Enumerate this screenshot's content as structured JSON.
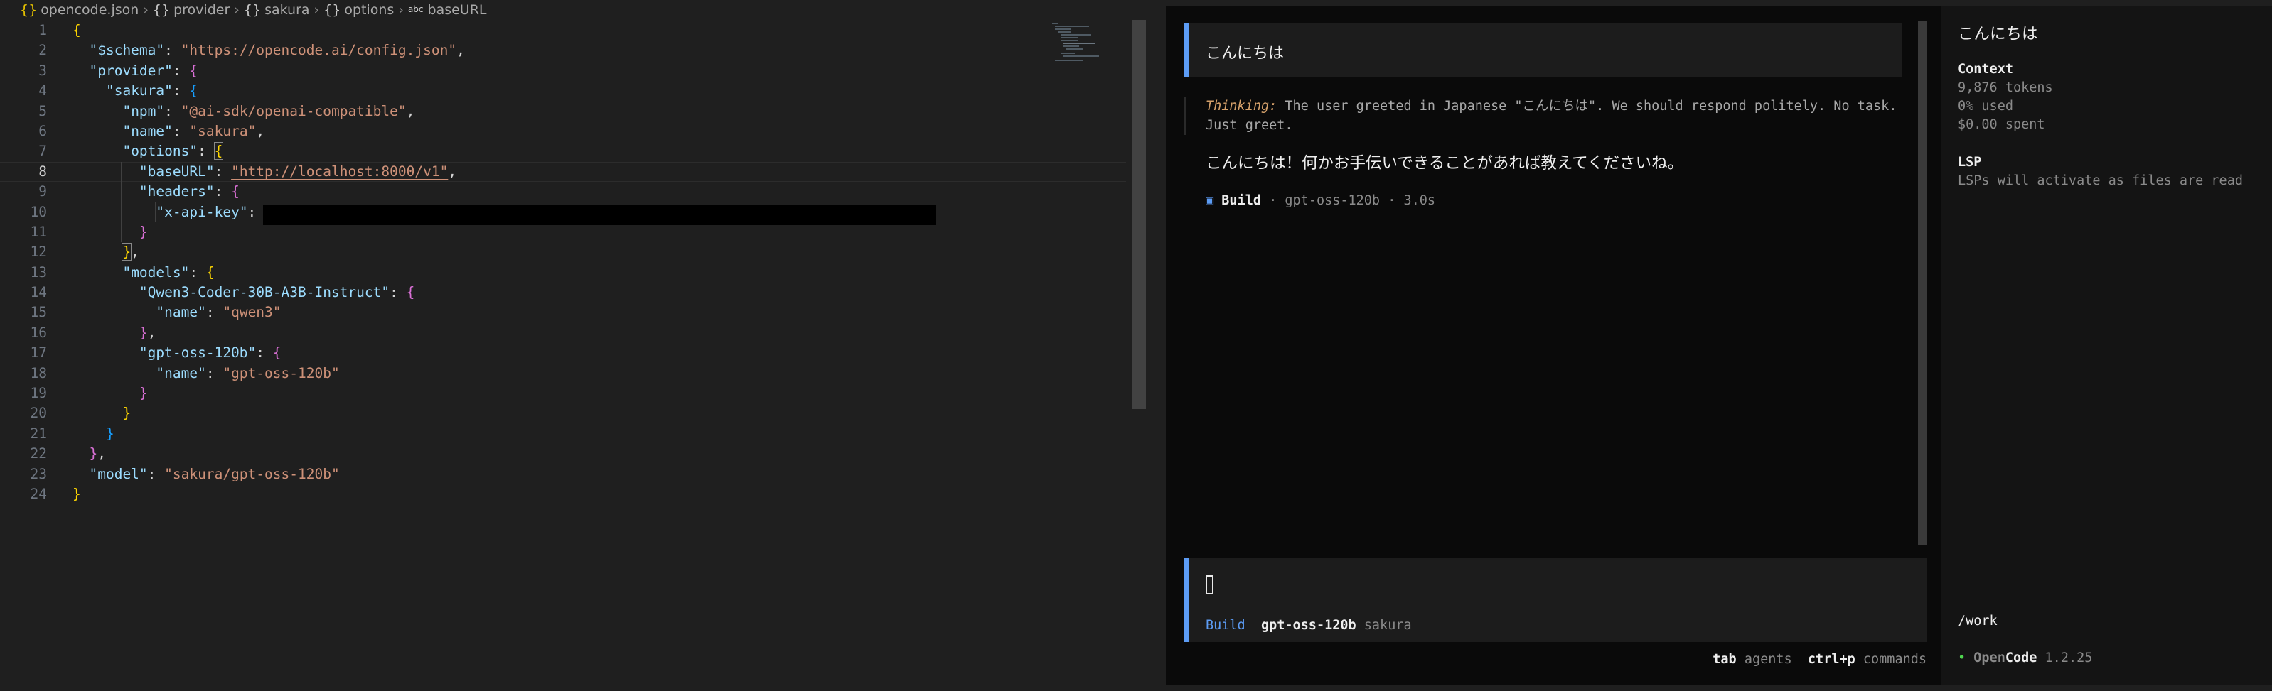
{
  "editor": {
    "breadcrumb": {
      "file": "opencode.json",
      "items": [
        "provider",
        "sakura",
        "options"
      ],
      "current": "baseURL",
      "abc": "abc"
    },
    "line_numbers": [
      "1",
      "2",
      "3",
      "4",
      "5",
      "6",
      "7",
      "8",
      "9",
      "10",
      "11",
      "12",
      "13",
      "14",
      "15",
      "16",
      "17",
      "18",
      "19",
      "20",
      "21",
      "22",
      "23",
      "24"
    ],
    "tokens": {
      "schema_key": "\"$schema\"",
      "schema_val": "\"https://opencode.ai/config.json\"",
      "provider_key": "\"provider\"",
      "sakura_key": "\"sakura\"",
      "npm_key": "\"npm\"",
      "npm_val": "\"@ai-sdk/openai-compatible\"",
      "name_key": "\"name\"",
      "sakura_name_val": "\"sakura\"",
      "options_key": "\"options\"",
      "baseurl_key": "\"baseURL\"",
      "baseurl_val": "\"http://localhost:8000/v1\"",
      "headers_key": "\"headers\"",
      "apikey_key": "\"x-api-key\"",
      "models_key": "\"models\"",
      "qwen_key": "\"Qwen3-Coder-30B-A3B-Instruct\"",
      "qwen_name_val": "\"qwen3\"",
      "gpt_key": "\"gpt-oss-120b\"",
      "gpt_name_val": "\"gpt-oss-120b\"",
      "model_key": "\"model\"",
      "model_val": "\"sakura/gpt-oss-120b\""
    }
  },
  "terminal": {
    "user_message": "こんにちは",
    "thinking_label": "Thinking:",
    "thinking_text": "The user greeted in Japanese \"こんにちは\". We should respond politely. No task. Just greet.",
    "reply": "こんにちは！何かお手伝いできることがあれば教えてくださいね。",
    "build": {
      "dot": "▣",
      "agent": "Build",
      "model": "gpt-oss-120b",
      "duration": "3.0s"
    },
    "input": {
      "agent": "Build",
      "model": "gpt-oss-120b",
      "provider": "sakura"
    },
    "hints": [
      {
        "key": "tab",
        "label": "agents"
      },
      {
        "key": "ctrl+p",
        "label": "commands"
      }
    ],
    "sidebar": {
      "title": "こんにちは",
      "context_heading": "Context",
      "tokens": "9,876 tokens",
      "used": "0% used",
      "spent": "$0.00 spent",
      "lsp_heading": "LSP",
      "lsp_text": "LSPs will activate as files are read",
      "path": "/work",
      "app_name_part1": "Open",
      "app_name_part2": "Code",
      "version": "1.2.25",
      "status_dot": "•"
    },
    "colors": {
      "accent": "#5c9cf5",
      "background": "#0a0a0a",
      "panel": "#1c1c1c",
      "status_green": "#4fd64f"
    }
  }
}
